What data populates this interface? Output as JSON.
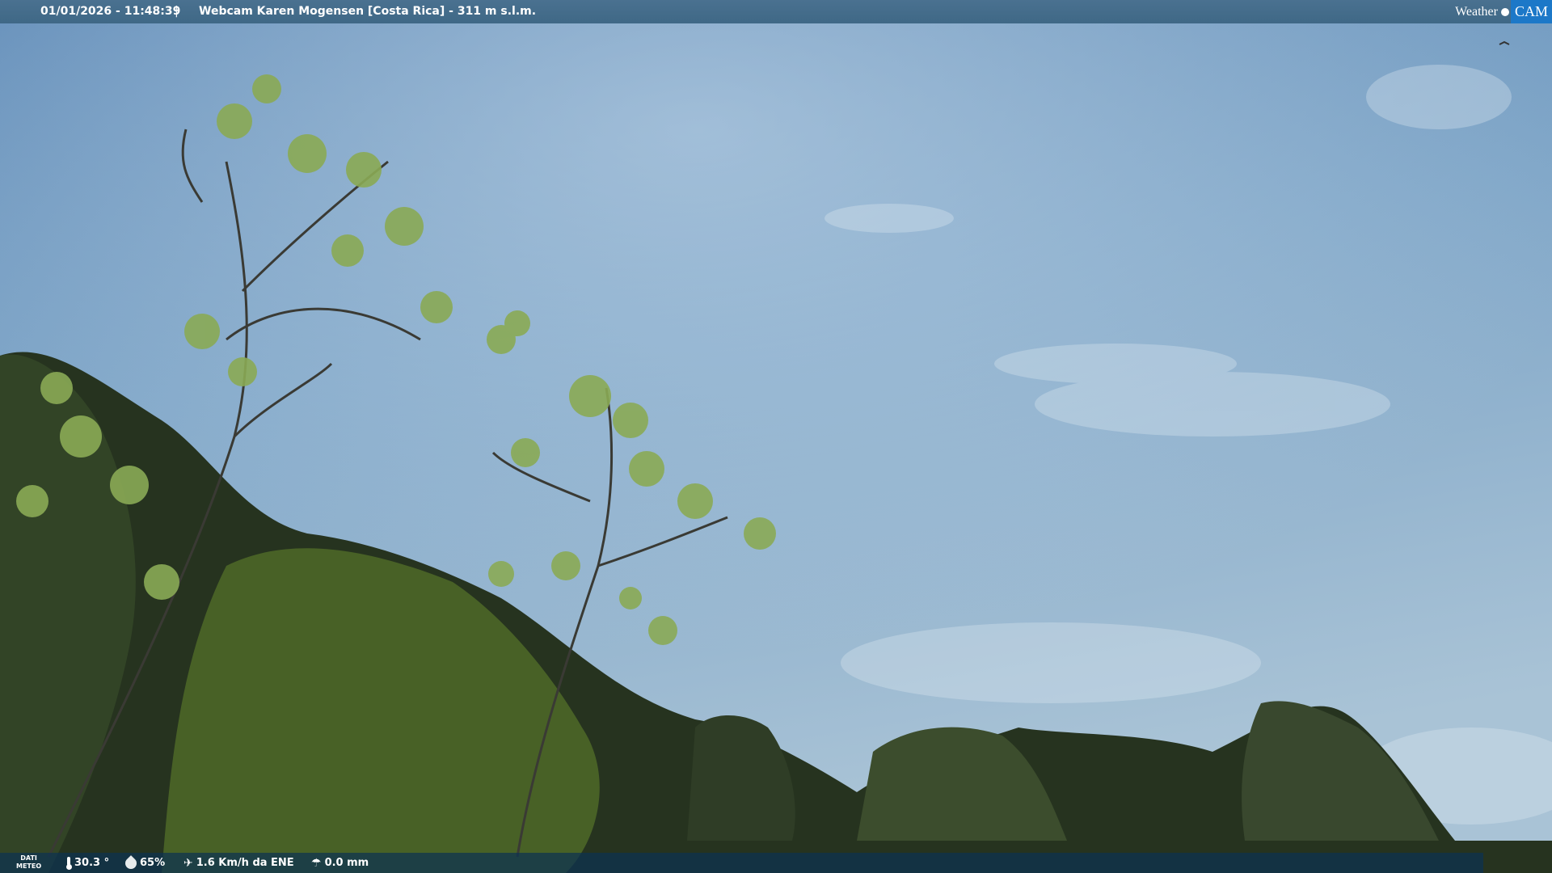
{
  "header": {
    "datetime": "01/01/2026 - 11:48:39",
    "separator": "|",
    "title": "Webcam Karen Mogensen [Costa Rica] - 311 m s.l.m."
  },
  "logo": {
    "left": "Weather",
    "right": "CAM"
  },
  "footer": {
    "label_line1": "DATI",
    "label_line2": "METEO",
    "temperature": "30.3 °",
    "humidity": "65%",
    "wind": "1.6 Km/h da ENE",
    "rain": "0.0 mm",
    "icons": [
      "thermometer-icon",
      "drop-icon",
      "wind-icon",
      "rain-icon"
    ]
  }
}
